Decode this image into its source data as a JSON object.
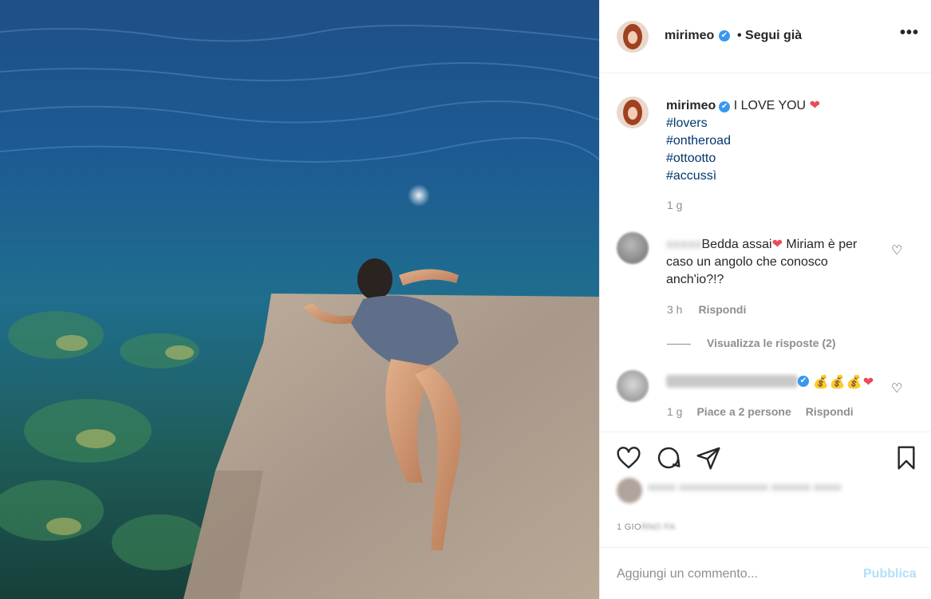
{
  "post": {
    "username": "mirimeo",
    "follow_status": "• Segui già",
    "more_icon": "more-horizontal-icon",
    "verified_mark": "✔"
  },
  "caption": {
    "username": "mirimeo",
    "text": "I LOVE YOU",
    "emoji": "❤",
    "hashtags": [
      "#lovers",
      "#ontheroad",
      "#ottootto",
      "#accussì"
    ],
    "time": "1 g"
  },
  "comments": [
    {
      "author_blurred": "xxxxx",
      "text": "Bedda assai",
      "emoji": "❤",
      "text2": " Miriam è per caso un angolo che conosco anch'io?!?",
      "time": "3 h",
      "reply": "Rispondi",
      "view_replies": "Visualizza le risposte (2)"
    },
    {
      "author_blurred": "",
      "emojis": "💰💰💰",
      "emoji_heart": "❤",
      "time": "1 g",
      "likes": "Piace a 2 persone",
      "reply": "Rispondi"
    }
  ],
  "likes_blurred": "xxxxx xxxxxxxxxxxxxxxx xxxxxxx xxxxx",
  "date_prefix": "1 GIO",
  "date_blur": "RNO FA",
  "add_comment": {
    "placeholder": "Aggiungi un commento...",
    "publish": "Pubblica"
  },
  "colors": {
    "link": "#00376b",
    "secondary": "#8e8e8e",
    "verified": "#3897f0",
    "publish_disabled": "#b2dffc"
  }
}
